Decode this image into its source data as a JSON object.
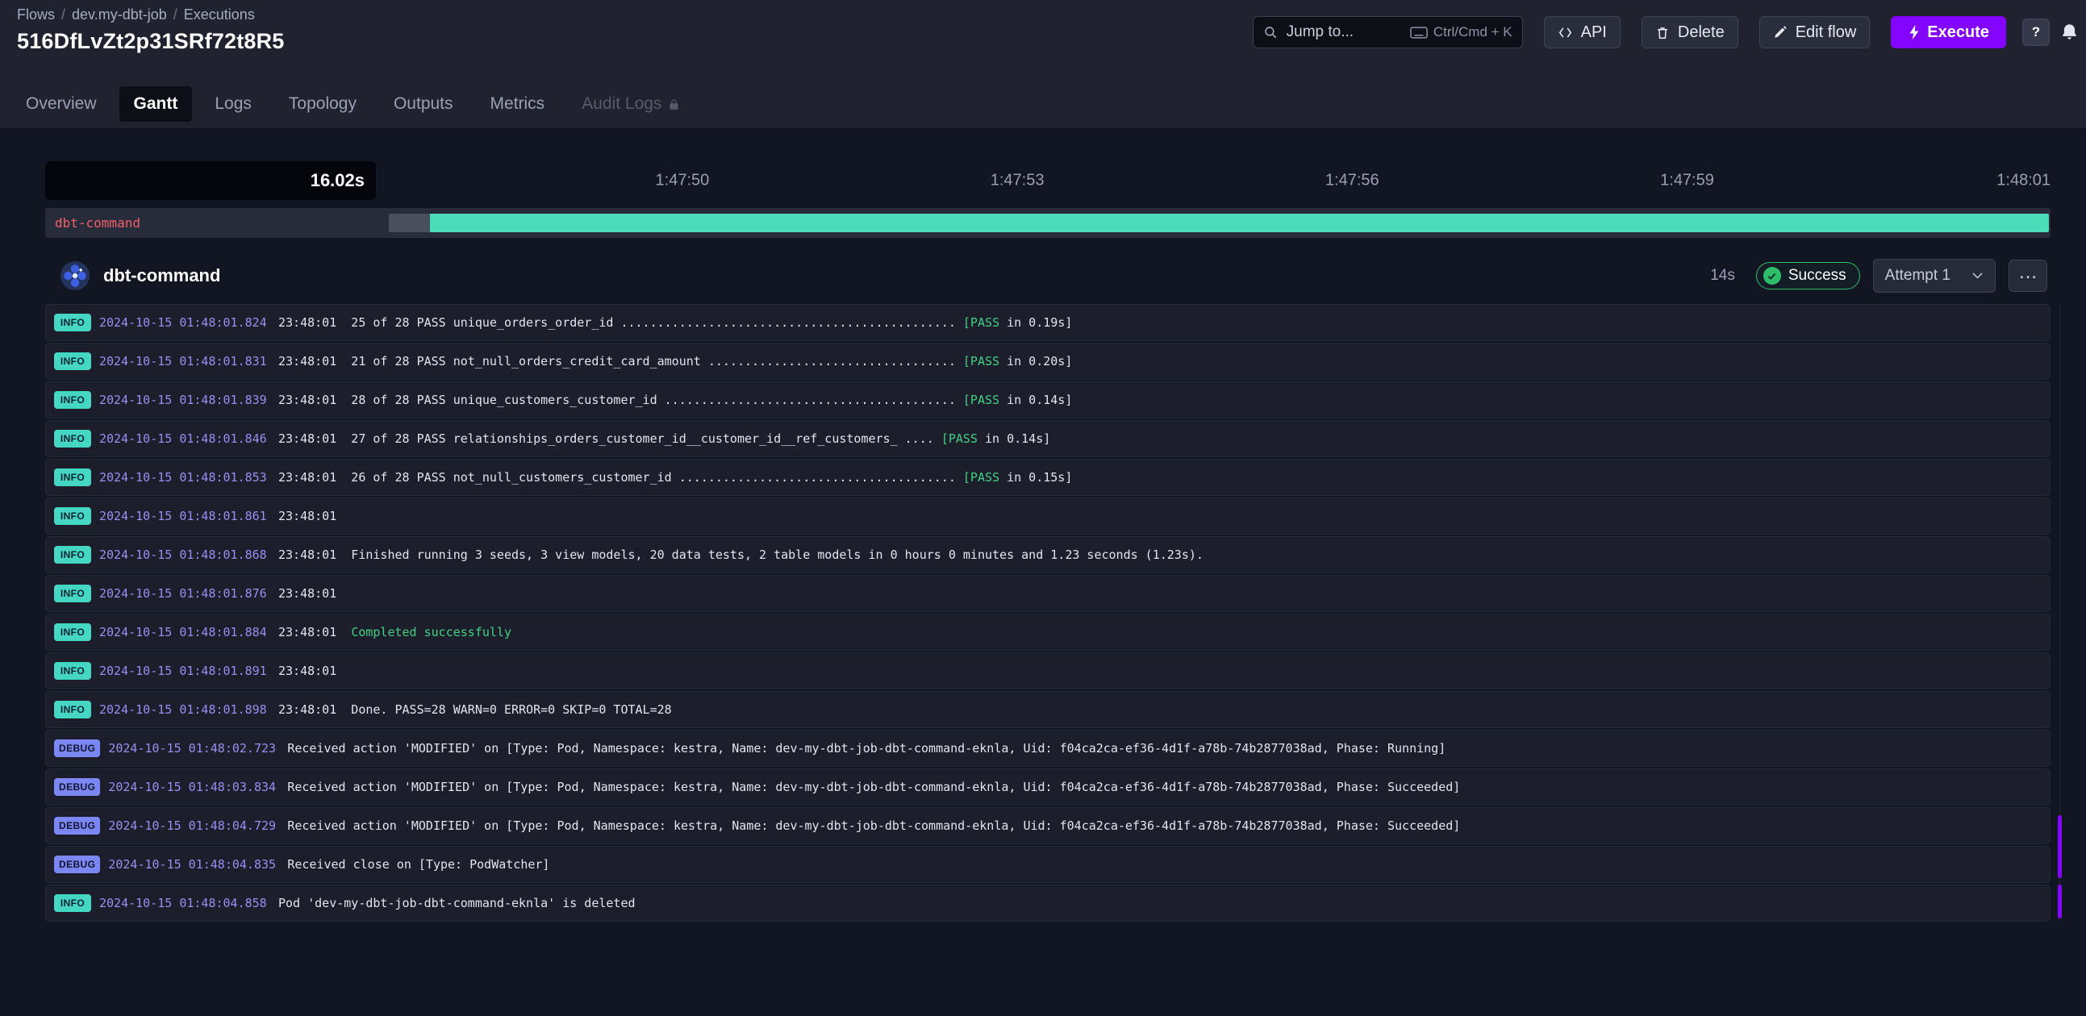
{
  "theme": {
    "accent": "#8405ff",
    "info": "#46d6c4",
    "debug": "#7b87f7",
    "success": "#2ebd6b",
    "success_text": "#43cf82",
    "bar": "#4bdcba",
    "pending": "#4a4f5e",
    "task_label": "#f2616c",
    "timestamp": "#9e8cf2"
  },
  "header": {
    "breadcrumb": [
      "Flows",
      "dev.my-dbt-job",
      "Executions"
    ],
    "title": "516DfLvZt2p31SRf72t8R5",
    "search": {
      "placeholder": "Jump to...",
      "shortcut": "Ctrl/Cmd + K"
    },
    "actions": {
      "api": "API",
      "delete": "Delete",
      "edit_flow": "Edit flow",
      "execute": "Execute",
      "help": "?"
    }
  },
  "tabs": [
    {
      "label": "Overview"
    },
    {
      "label": "Gantt",
      "active": true
    },
    {
      "label": "Logs"
    },
    {
      "label": "Topology"
    },
    {
      "label": "Outputs"
    },
    {
      "label": "Metrics"
    },
    {
      "label": "Audit Logs",
      "locked": true
    }
  ],
  "gantt": {
    "duration_label": "16.02s",
    "ticks": [
      "1:47:50",
      "1:47:53",
      "1:47:56",
      "1:47:59",
      "1:48:01"
    ],
    "row": {
      "label": "dbt-command"
    }
  },
  "task": {
    "name": "dbt-command",
    "duration": "14s",
    "status": "Success",
    "attempt": "Attempt 1",
    "menu_icon": "…"
  },
  "logs": [
    {
      "level": "INFO",
      "ts": "2024-10-15 01:48:01.824",
      "msg": [
        {
          "t": "23:48:01  25 of 28 PASS unique_orders_order_id .............................................. "
        },
        {
          "t": "[PASS",
          "c": "green"
        },
        {
          "t": " in 0.19s]"
        }
      ]
    },
    {
      "level": "INFO",
      "ts": "2024-10-15 01:48:01.831",
      "msg": [
        {
          "t": "23:48:01  21 of 28 PASS not_null_orders_credit_card_amount .................................. "
        },
        {
          "t": "[PASS",
          "c": "green"
        },
        {
          "t": " in 0.20s]"
        }
      ]
    },
    {
      "level": "INFO",
      "ts": "2024-10-15 01:48:01.839",
      "msg": [
        {
          "t": "23:48:01  28 of 28 PASS unique_customers_customer_id ........................................ "
        },
        {
          "t": "[PASS",
          "c": "green"
        },
        {
          "t": " in 0.14s]"
        }
      ]
    },
    {
      "level": "INFO",
      "ts": "2024-10-15 01:48:01.846",
      "msg": [
        {
          "t": "23:48:01  27 of 28 PASS relationships_orders_customer_id__customer_id__ref_customers_ .... "
        },
        {
          "t": "[PASS",
          "c": "green"
        },
        {
          "t": " in 0.14s]"
        }
      ]
    },
    {
      "level": "INFO",
      "ts": "2024-10-15 01:48:01.853",
      "msg": [
        {
          "t": "23:48:01  26 of 28 PASS not_null_customers_customer_id ...................................... "
        },
        {
          "t": "[PASS",
          "c": "green"
        },
        {
          "t": " in 0.15s]"
        }
      ]
    },
    {
      "level": "INFO",
      "ts": "2024-10-15 01:48:01.861",
      "msg": [
        {
          "t": "23:48:01"
        }
      ]
    },
    {
      "level": "INFO",
      "ts": "2024-10-15 01:48:01.868",
      "msg": [
        {
          "t": "23:48:01  Finished running 3 seeds, 3 view models, 20 data tests, 2 table models in 0 hours 0 minutes and 1.23 seconds (1.23s)."
        }
      ]
    },
    {
      "level": "INFO",
      "ts": "2024-10-15 01:48:01.876",
      "msg": [
        {
          "t": "23:48:01"
        }
      ]
    },
    {
      "level": "INFO",
      "ts": "2024-10-15 01:48:01.884",
      "msg": [
        {
          "t": "23:48:01  "
        },
        {
          "t": "Completed successfully",
          "c": "green"
        }
      ]
    },
    {
      "level": "INFO",
      "ts": "2024-10-15 01:48:01.891",
      "msg": [
        {
          "t": "23:48:01"
        }
      ]
    },
    {
      "level": "INFO",
      "ts": "2024-10-15 01:48:01.898",
      "msg": [
        {
          "t": "23:48:01  Done. PASS=28 WARN=0 ERROR=0 SKIP=0 TOTAL=28"
        }
      ]
    },
    {
      "level": "DEBUG",
      "ts": "2024-10-15 01:48:02.723",
      "msg": [
        {
          "t": "Received action 'MODIFIED' on [Type: Pod, Namespace: kestra, Name: dev-my-dbt-job-dbt-command-eknla, Uid: f04ca2ca-ef36-4d1f-a78b-74b2877038ad, Phase: Running]"
        }
      ]
    },
    {
      "level": "DEBUG",
      "ts": "2024-10-15 01:48:03.834",
      "msg": [
        {
          "t": "Received action 'MODIFIED' on [Type: Pod, Namespace: kestra, Name: dev-my-dbt-job-dbt-command-eknla, Uid: f04ca2ca-ef36-4d1f-a78b-74b2877038ad, Phase: Succeeded]"
        }
      ]
    },
    {
      "level": "DEBUG",
      "ts": "2024-10-15 01:48:04.729",
      "msg": [
        {
          "t": "Received action 'MODIFIED' on [Type: Pod, Namespace: kestra, Name: dev-my-dbt-job-dbt-command-eknla, Uid: f04ca2ca-ef36-4d1f-a78b-74b2877038ad, Phase: Succeeded]"
        }
      ]
    },
    {
      "level": "DEBUG",
      "ts": "2024-10-15 01:48:04.835",
      "msg": [
        {
          "t": "Received close on [Type: PodWatcher]"
        }
      ]
    },
    {
      "level": "INFO",
      "ts": "2024-10-15 01:48:04.858",
      "msg": [
        {
          "t": "Pod 'dev-my-dbt-job-dbt-command-eknla' is deleted"
        }
      ]
    }
  ]
}
